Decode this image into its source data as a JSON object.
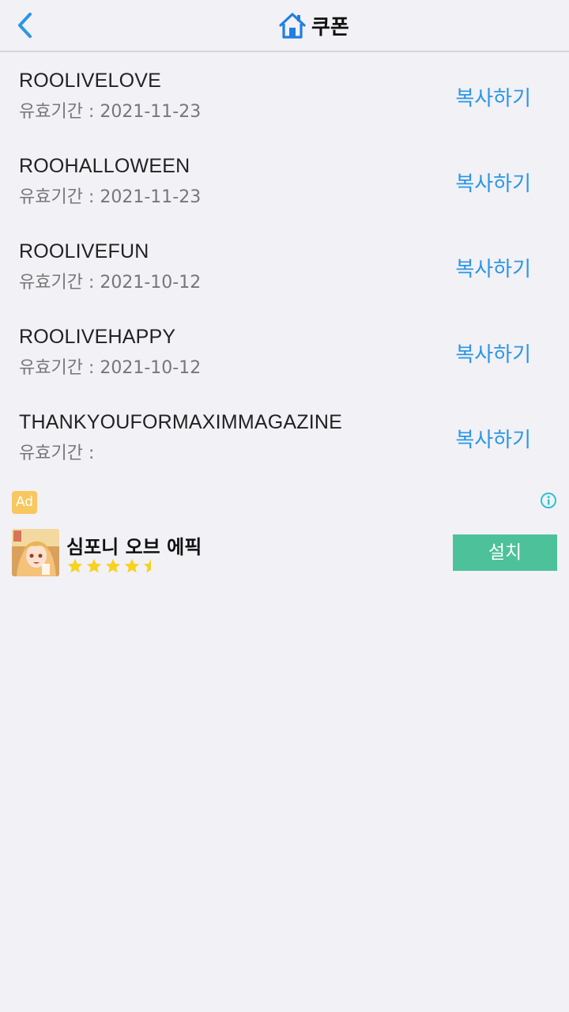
{
  "header": {
    "title": "쿠폰",
    "back_icon": "chevron-left-icon",
    "home_icon": "home-icon",
    "accent_color": "#2a96e6"
  },
  "coupons": [
    {
      "code": "ROOLIVELOVE",
      "expiry": "유효기간 : 2021-11-23",
      "copy_label": "복사하기"
    },
    {
      "code": "ROOHALLOWEEN",
      "expiry": "유효기간 : 2021-11-23",
      "copy_label": "복사하기"
    },
    {
      "code": "ROOLIVEFUN",
      "expiry": "유효기간 : 2021-10-12",
      "copy_label": "복사하기"
    },
    {
      "code": "ROOLIVEHAPPY",
      "expiry": "유효기간 : 2021-10-12",
      "copy_label": "복사하기"
    },
    {
      "code": "THANKYOUFORMAXIMMAGAZINE",
      "expiry": "유효기간 :",
      "copy_label": "복사하기"
    }
  ],
  "ad": {
    "badge": "Ad",
    "info_icon": "info-icon",
    "app_name": "심포니 오브 에픽",
    "rating": 4.5,
    "rating_max": 5,
    "install_label": "설치",
    "install_color": "#4dc29a"
  }
}
